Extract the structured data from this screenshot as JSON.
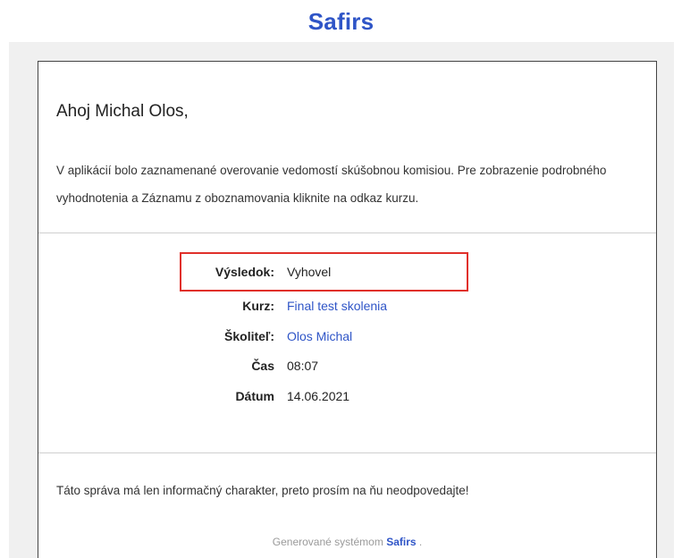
{
  "header": {
    "brand": "Safirs"
  },
  "email": {
    "greeting": "Ahoj Michal Olos,",
    "intro": "V aplikácií bolo zaznamenané overovanie vedomostí skúšobnou komisiou. Pre zobrazenie podrobného vyhodnotenia a Záznamu z oboznamovania kliknite na odkaz kurzu.",
    "details": {
      "result_label": "Výsledok:",
      "result_value": "Vyhovel",
      "course_label": "Kurz:",
      "course_value": "Final test skolenia",
      "trainer_label": "Školiteľ:",
      "trainer_value": "Olos Michal",
      "time_label": "Čas",
      "time_value": "08:07",
      "date_label": "Dátum",
      "date_value": "14.06.2021"
    },
    "footer_note": "Táto správa má len informačný charakter, preto prosím na ňu neodpovedajte!",
    "generated_prefix": "Generované systémom",
    "generated_brand": "Safirs",
    "generated_suffix": " ."
  },
  "colors": {
    "brand": "#2f55c7",
    "highlight": "#e0302a"
  }
}
